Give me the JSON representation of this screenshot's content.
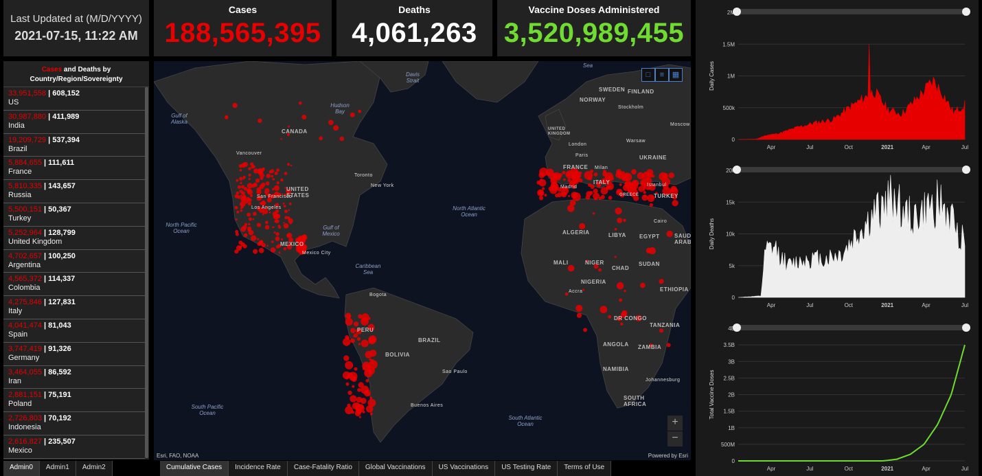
{
  "header": {
    "updated_label": "Last Updated at (M/D/YYYY)",
    "updated_value": "2021-07-15, 11:22 AM",
    "cases_label": "Cases",
    "cases_value": "188,565,395",
    "deaths_label": "Deaths",
    "deaths_value": "4,061,263",
    "vacc_label": "Vaccine Doses Administered",
    "vacc_value": "3,520,989,455"
  },
  "list": {
    "title_cases": "Cases",
    "title_and": " and ",
    "title_deaths": "Deaths",
    "title_rest": " by",
    "title_line2": "Country/Region/Sovereignty",
    "rows": [
      {
        "cases": "33,951,558",
        "deaths": "608,152",
        "name": "US"
      },
      {
        "cases": "30,987,880",
        "deaths": "411,989",
        "name": "India"
      },
      {
        "cases": "19,209,729",
        "deaths": "537,394",
        "name": "Brazil"
      },
      {
        "cases": "5,884,655",
        "deaths": "111,611",
        "name": "France"
      },
      {
        "cases": "5,810,335",
        "deaths": "143,657",
        "name": "Russia"
      },
      {
        "cases": "5,500,151",
        "deaths": "50,367",
        "name": "Turkey"
      },
      {
        "cases": "5,252,964",
        "deaths": "128,799",
        "name": "United Kingdom"
      },
      {
        "cases": "4,702,657",
        "deaths": "100,250",
        "name": "Argentina"
      },
      {
        "cases": "4,565,372",
        "deaths": "114,337",
        "name": "Colombia"
      },
      {
        "cases": "4,275,846",
        "deaths": "127,831",
        "name": "Italy"
      },
      {
        "cases": "4,041,474",
        "deaths": "81,043",
        "name": "Spain"
      },
      {
        "cases": "3,747,419",
        "deaths": "91,326",
        "name": "Germany"
      },
      {
        "cases": "3,464,055",
        "deaths": "86,592",
        "name": "Iran"
      },
      {
        "cases": "2,881,151",
        "deaths": "75,191",
        "name": "Poland"
      },
      {
        "cases": "2,726,803",
        "deaths": "70,192",
        "name": "Indonesia"
      },
      {
        "cases": "2,616,827",
        "deaths": "235,507",
        "name": "Mexico"
      }
    ]
  },
  "admin_tabs": [
    "Admin0",
    "Admin1",
    "Admin2"
  ],
  "map_tabs": [
    "Cumulative Cases",
    "Incidence Rate",
    "Case-Fatality Ratio",
    "Global Vaccinations",
    "US Vaccinations",
    "US Testing Rate",
    "Terms of Use"
  ],
  "map": {
    "attribution_left": "Esri, FAO, NOAA",
    "attribution_right": "Powered by Esri",
    "zoom_in": "+",
    "zoom_out": "−",
    "countries": [
      "CANADA",
      "UNITED STATES",
      "MEXICO",
      "BRAZIL",
      "PERU",
      "BOLIVIA",
      "SWEDEN",
      "FINLAND",
      "NORWAY",
      "UNITED KINGDOM",
      "FRANCE",
      "UKRAINE",
      "ITALY",
      "GREECE",
      "TURKEY",
      "ALGERIA",
      "LIBYA",
      "EGYPT",
      "MALI",
      "NIGER",
      "CHAD",
      "SUDAN",
      "NIGERIA",
      "ETHIOPIA",
      "DR CONGO",
      "TANZANIA",
      "ANGOLA",
      "ZAMBIA",
      "NAMIBIA",
      "SOUTH AFRICA",
      "SAUDI ARABIA"
    ],
    "cities": [
      "Vancouver",
      "San Francisco",
      "Los Angeles",
      "Toronto",
      "New York",
      "Mexico City",
      "Bogota",
      "Sao Paulo",
      "Buenos Aires",
      "London",
      "Paris",
      "Madrid",
      "Milan",
      "Warsaw",
      "Stockholm",
      "Moscow",
      "Istanbul",
      "Cairo",
      "Accra",
      "Johannesburg"
    ],
    "oceans": [
      "Gulf of Alaska",
      "Hudson Bay",
      "Davis Strait",
      "North Pacific Ocean",
      "North Atlantic Ocean",
      "Caribbean Sea",
      "South Pacific Ocean",
      "South Atlantic Ocean",
      "Sea",
      "Gulf of Mexico"
    ]
  },
  "chart_data": [
    {
      "type": "bar",
      "ylabel": "Daily Cases",
      "color": "#e60000",
      "yticks": [
        "0",
        "500k",
        "1M",
        "1.5M",
        "2M"
      ],
      "ylim": [
        0,
        2000000
      ],
      "xticks": [
        "Apr",
        "Jul",
        "Oct",
        "2021",
        "Apr",
        "Jul"
      ],
      "series_shape": [
        [
          0,
          0
        ],
        [
          0.08,
          5000
        ],
        [
          0.12,
          60000
        ],
        [
          0.18,
          90000
        ],
        [
          0.26,
          180000
        ],
        [
          0.34,
          250000
        ],
        [
          0.42,
          300000
        ],
        [
          0.5,
          500000
        ],
        [
          0.57,
          650000
        ],
        [
          0.6,
          720000
        ],
        [
          0.66,
          450000
        ],
        [
          0.72,
          380000
        ],
        [
          0.8,
          650000
        ],
        [
          0.86,
          880000
        ],
        [
          0.9,
          700000
        ],
        [
          0.95,
          400000
        ],
        [
          1.0,
          520000
        ]
      ],
      "peak": {
        "x": 0.58,
        "value": 1500000
      }
    },
    {
      "type": "bar",
      "ylabel": "Daily Deaths",
      "color": "#eeeeee",
      "yticks": [
        "0",
        "5k",
        "10k",
        "15k",
        "20k"
      ],
      "ylim": [
        0,
        20000
      ],
      "xticks": [
        "Apr",
        "Jul",
        "Oct",
        "2021",
        "Apr",
        "Jul"
      ],
      "series_shape": [
        [
          0,
          0
        ],
        [
          0.1,
          200
        ],
        [
          0.12,
          6500
        ],
        [
          0.16,
          7000
        ],
        [
          0.22,
          4500
        ],
        [
          0.3,
          5500
        ],
        [
          0.38,
          5500
        ],
        [
          0.46,
          6200
        ],
        [
          0.54,
          9500
        ],
        [
          0.64,
          13000
        ],
        [
          0.69,
          14500
        ],
        [
          0.74,
          11500
        ],
        [
          0.8,
          11500
        ],
        [
          0.88,
          13500
        ],
        [
          0.94,
          11000
        ],
        [
          1.0,
          8000
        ]
      ]
    },
    {
      "type": "line",
      "ylabel": "Total Vaccine Doses",
      "color": "#70db30",
      "yticks": [
        "0",
        "500M",
        "1B",
        "1.5B",
        "2B",
        "2.5B",
        "3B",
        "3.5B",
        "4B"
      ],
      "ylim": [
        0,
        4000000000
      ],
      "xticks": [
        "Apr",
        "Jul",
        "Oct",
        "2021",
        "Apr",
        "Jul"
      ],
      "series_shape": [
        [
          0,
          0
        ],
        [
          0.64,
          0
        ],
        [
          0.7,
          50000000
        ],
        [
          0.76,
          200000000
        ],
        [
          0.82,
          500000000
        ],
        [
          0.88,
          1100000000
        ],
        [
          0.94,
          2000000000
        ],
        [
          1.0,
          3500000000
        ]
      ]
    }
  ]
}
